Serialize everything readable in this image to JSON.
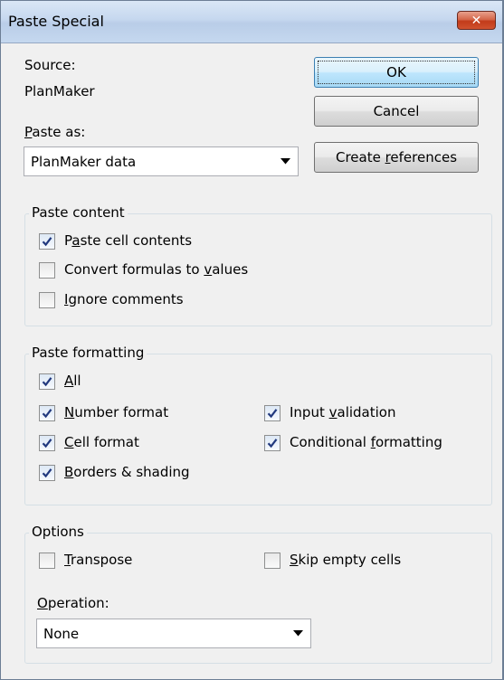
{
  "window": {
    "title": "Paste Special",
    "close_glyph": "✕"
  },
  "source": {
    "label": "Source:",
    "value": "PlanMaker"
  },
  "paste_as": {
    "label_prefix": "",
    "label_hotkey": "P",
    "label_rest": "aste as:",
    "selected": "PlanMaker data"
  },
  "buttons": {
    "ok": "OK",
    "cancel": "Cancel",
    "create_refs_prefix": "Create ",
    "create_refs_hotkey": "r",
    "create_refs_rest": "eferences"
  },
  "paste_content": {
    "title": "Paste content",
    "items": [
      {
        "pre": "P",
        "hot": "a",
        "post": "ste cell contents",
        "checked": true
      },
      {
        "pre": "Convert formulas to ",
        "hot": "v",
        "post": "alues",
        "checked": false
      },
      {
        "pre": "",
        "hot": "I",
        "post": "gnore comments",
        "checked": false
      }
    ]
  },
  "paste_formatting": {
    "title": "Paste formatting",
    "all": {
      "pre": "",
      "hot": "A",
      "post": "ll",
      "checked": true
    },
    "number_format": {
      "pre": "",
      "hot": "N",
      "post": "umber format",
      "checked": true
    },
    "cell_format": {
      "pre": "",
      "hot": "C",
      "post": "ell format",
      "checked": true
    },
    "borders_shading": {
      "pre": "",
      "hot": "B",
      "post": "orders & shading",
      "checked": true
    },
    "input_validation": {
      "pre": "Input ",
      "hot": "v",
      "post": "alidation",
      "checked": true
    },
    "conditional_formatting": {
      "pre": "Conditional ",
      "hot": "f",
      "post": "ormatting",
      "checked": true
    }
  },
  "options": {
    "title": "Options",
    "transpose": {
      "pre": "",
      "hot": "T",
      "post": "ranspose",
      "checked": false
    },
    "skip_empty": {
      "pre": "",
      "hot": "S",
      "post": "kip empty cells",
      "checked": false
    },
    "operation_label_pre": "",
    "operation_label_hot": "O",
    "operation_label_post": "peration:",
    "operation_selected": "None"
  },
  "icons": {
    "combo_arrow": "chevron-down-icon",
    "check": "checkmark-icon",
    "close": "close-icon"
  },
  "colors": {
    "close_red": "#c23b1a",
    "default_button_border": "#3c7fb1",
    "group_border": "#d5dfe5"
  }
}
